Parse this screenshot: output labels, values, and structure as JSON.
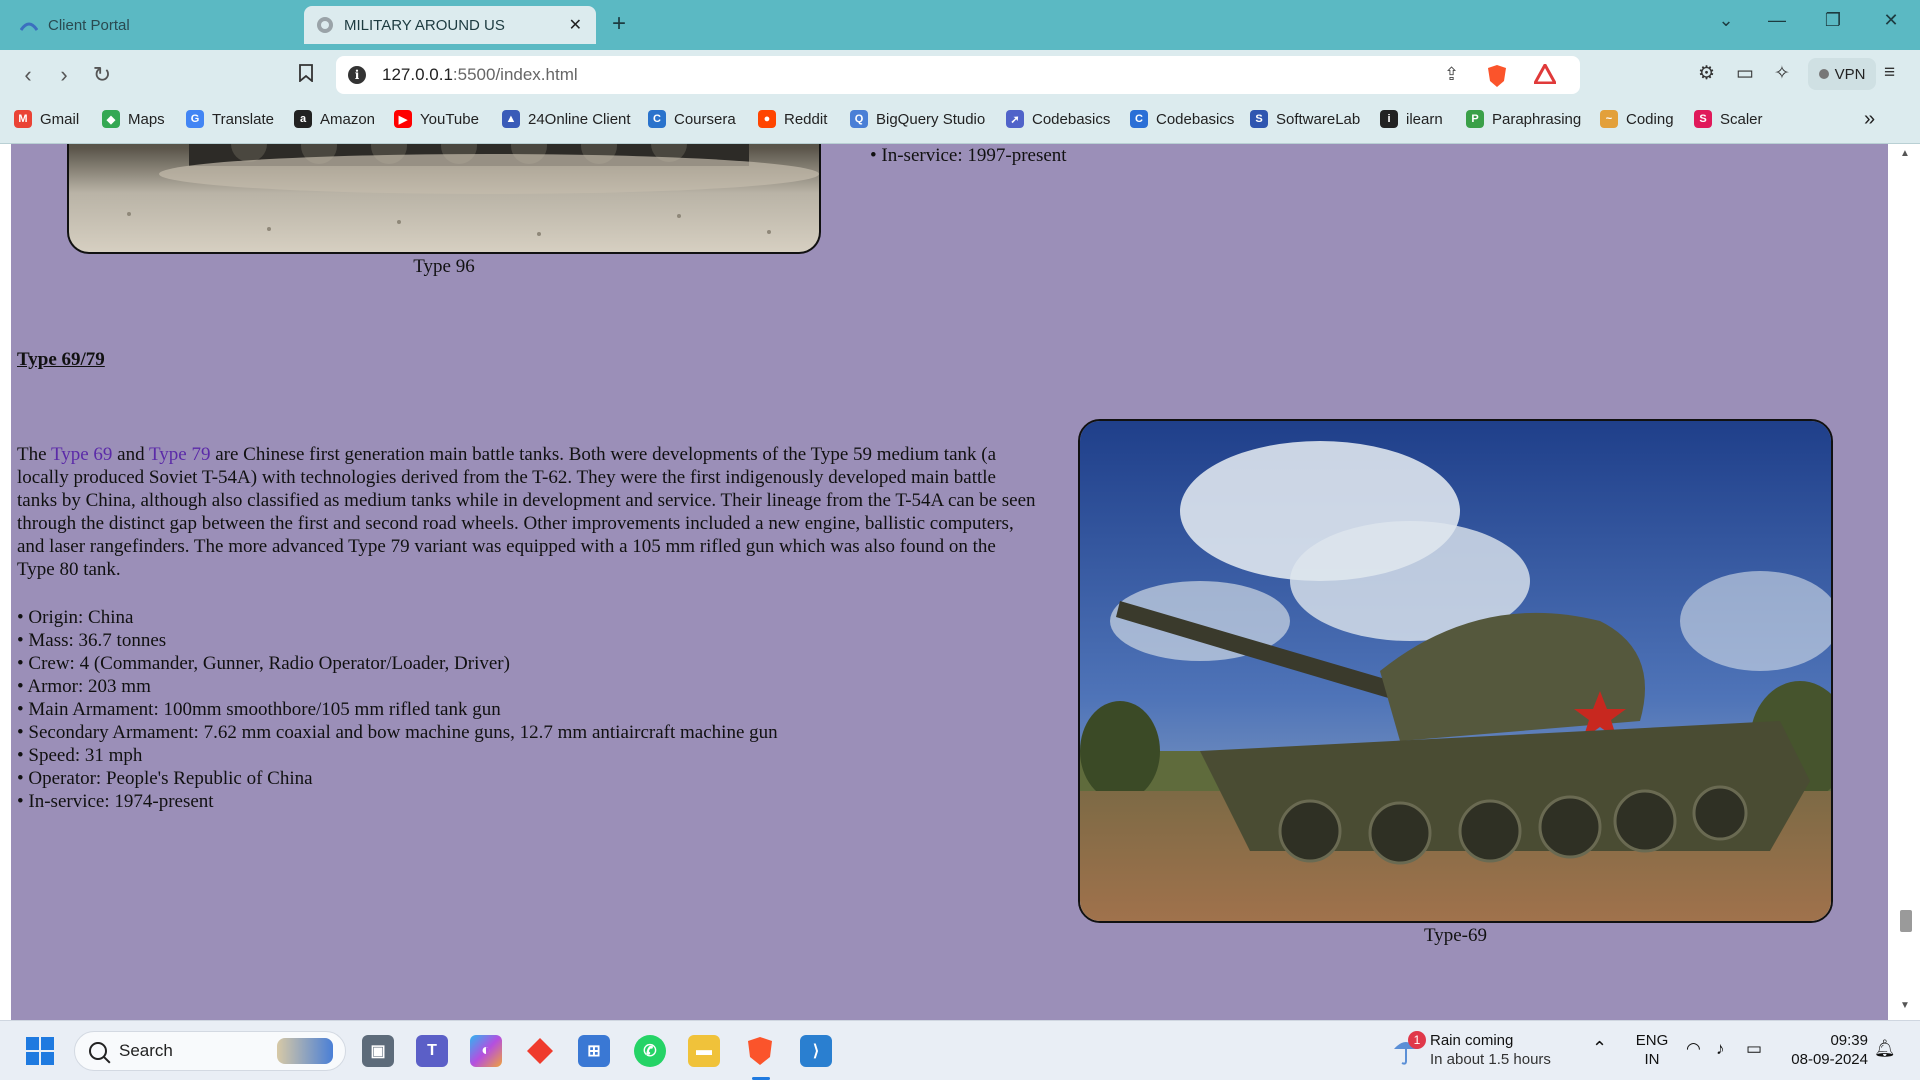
{
  "browser": {
    "tabs": [
      {
        "label": "Client Portal",
        "active": false
      },
      {
        "label": "MILITARY AROUND US",
        "active": true
      }
    ],
    "new_tab": "+",
    "url_host": "127.0.0.1",
    "url_rest": ":5500/index.html",
    "vpn_label": "VPN",
    "bookmarks": [
      {
        "label": "Gmail",
        "icon": "gmail-icon",
        "color": "#ea4335",
        "glyph": "M"
      },
      {
        "label": "Maps",
        "icon": "maps-icon",
        "color": "#34a853",
        "glyph": "◆"
      },
      {
        "label": "Translate",
        "icon": "translate-icon",
        "color": "#4285f4",
        "glyph": "G"
      },
      {
        "label": "Amazon",
        "icon": "amazon-icon",
        "color": "#222222",
        "glyph": "a"
      },
      {
        "label": "YouTube",
        "icon": "youtube-icon",
        "color": "#ff0000",
        "glyph": "▶"
      },
      {
        "label": "24Online Client",
        "icon": "24online-icon",
        "color": "#3a5bb8",
        "glyph": "▲"
      },
      {
        "label": "Coursera",
        "icon": "coursera-icon",
        "color": "#2a73cc",
        "glyph": "C"
      },
      {
        "label": "Reddit",
        "icon": "reddit-icon",
        "color": "#ff4500",
        "glyph": "●"
      },
      {
        "label": "BigQuery Studio",
        "icon": "bigquery-icon",
        "color": "#4a7fd6",
        "glyph": "Q"
      },
      {
        "label": "Codebasics",
        "icon": "rocket-icon",
        "color": "#5063c9",
        "glyph": "➚"
      },
      {
        "label": "Codebasics",
        "icon": "codebasics-icon",
        "color": "#2b6fd6",
        "glyph": "C"
      },
      {
        "label": "SoftwareLab",
        "icon": "softwarelab-icon",
        "color": "#2f56b0",
        "glyph": "S"
      },
      {
        "label": "ilearn",
        "icon": "ilearn-icon",
        "color": "#222222",
        "glyph": "i"
      },
      {
        "label": "Paraphrasing",
        "icon": "paraphrasing-icon",
        "color": "#3aa048",
        "glyph": "P"
      },
      {
        "label": "Coding",
        "icon": "coding-icon",
        "color": "#e3a03a",
        "glyph": "~"
      },
      {
        "label": "Scaler",
        "icon": "scaler-icon",
        "color": "#e0195a",
        "glyph": "S"
      }
    ]
  },
  "page": {
    "prev_inservice": "• In-service: 1997-present",
    "prev_caption": "Type 96",
    "heading": "Type 69/79",
    "para_prefix": "The ",
    "link1": "Type 69",
    "para_and": " and ",
    "link2": "Type 79",
    "para_body": " are Chinese first generation main battle tanks. Both were developments of the Type 59 medium tank (a locally produced Soviet T-54A) with technologies derived from the T-62. They were the first indigenously developed main battle tanks by China, although also classified as medium tanks while in development and service. Their lineage from the T-54A can be seen through the distinct gap between the first and second road wheels. Other improvements included a new engine, ballistic computers, and laser rangefinders. The more advanced Type 79 variant was equipped with a 105 mm rifled gun which was also found on the Type 80 tank.",
    "specs": [
      "• Origin: China",
      "• Mass: 36.7 tonnes",
      "• Crew: 4 (Commander, Gunner, Radio Operator/Loader, Driver)",
      "• Armor: 203 mm",
      "• Main Armament: 100mm smoothbore/105 mm rifled tank gun",
      "• Secondary Armament: 7.62 mm coaxial and bow machine guns, 12.7 mm antiaircraft machine gun",
      "• Speed: 31 mph",
      "• Operator: People's Republic of China",
      "• In-service: 1974-present"
    ],
    "image_caption": "Type-69"
  },
  "taskbar": {
    "search_label": "Search",
    "weather_title": "Rain coming",
    "weather_sub": "In about 1.5 hours",
    "weather_badge": "1",
    "lang": "ENG",
    "region": "IN",
    "time": "09:39",
    "date": "08-09-2024"
  }
}
